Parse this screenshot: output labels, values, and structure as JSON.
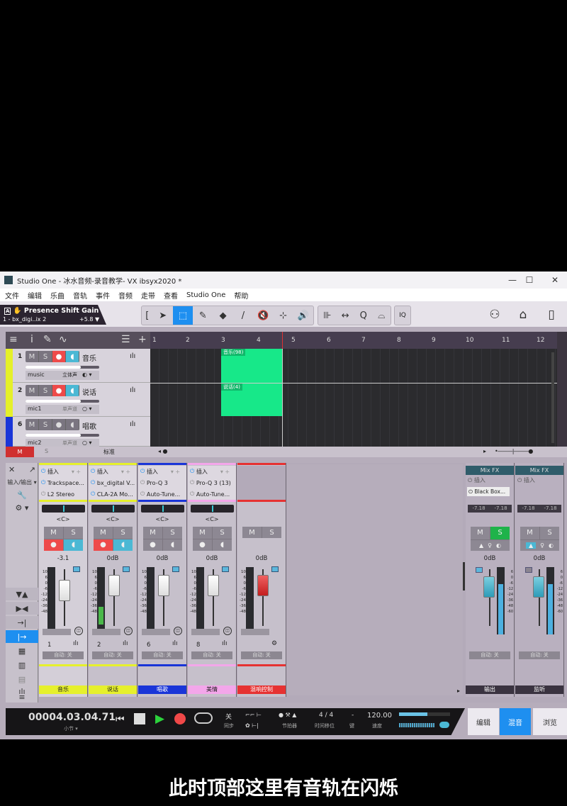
{
  "window": {
    "title": "Studio One - 冰水音频-录音教学- VX  ibsyx2020  *",
    "controls": {
      "minimize": "—",
      "maximize": "☐",
      "close": "✕"
    }
  },
  "menu": [
    "文件",
    "编辑",
    "乐曲",
    "音轨",
    "事件",
    "音频",
    "走带",
    "查看",
    "Studio One",
    "帮助"
  ],
  "info_box": {
    "title": "Presence Shift Gain",
    "device": "1 - bx_digi..ix 2",
    "value": "+5.8 ▼",
    "icons": [
      "A",
      "✋"
    ]
  },
  "toolbar": {
    "tools": [
      {
        "name": "bracket",
        "glyph": "["
      },
      {
        "name": "arrow-tool",
        "glyph": "➤"
      },
      {
        "name": "range-tool",
        "glyph": "⬚",
        "active": true
      },
      {
        "name": "split-tool",
        "glyph": "✎"
      },
      {
        "name": "eraser-tool",
        "glyph": "◆"
      },
      {
        "name": "paint-tool",
        "glyph": "/"
      },
      {
        "name": "mute-tool",
        "glyph": "🔇"
      },
      {
        "name": "bend-tool",
        "glyph": "⊹"
      },
      {
        "name": "listen-tool",
        "glyph": "🔊"
      }
    ],
    "group2": [
      {
        "name": "snap",
        "glyph": "⊪"
      },
      {
        "name": "stretch",
        "glyph": "↔"
      },
      {
        "name": "quantize",
        "glyph": "Q"
      },
      {
        "name": "autoscroll",
        "glyph": "⌓"
      }
    ],
    "iq": "IQ",
    "right_icons": [
      "user-icon",
      "home-icon",
      "layout-icon"
    ]
  },
  "arrange": {
    "header_icons": [
      "≡",
      "i",
      "✎",
      "∿",
      "☰",
      "+"
    ],
    "tracks": [
      {
        "num": "1",
        "name": "音乐",
        "input": "music",
        "mode": "立体声",
        "color": "#e5f02a",
        "volume": 0.75,
        "armed": true
      },
      {
        "num": "2",
        "name": "说话",
        "input": "mic1",
        "mode": "单声道",
        "color": "#e5f02a",
        "volume": 0.75,
        "armed": true
      },
      {
        "num": "6",
        "name": "唱歌",
        "input": "mic2",
        "mode": "单声道",
        "color": "#1a35d8",
        "volume": 0.75,
        "armed": false
      }
    ],
    "buttons": {
      "m": "M",
      "s": "S"
    },
    "ruler": [
      "1",
      "2",
      "3",
      "4",
      "5",
      "6",
      "7",
      "8",
      "9",
      "10",
      "11",
      "12"
    ],
    "clips": [
      {
        "label": "音乐(98)",
        "track": 0
      },
      {
        "label": "说话(4)",
        "track": 1
      }
    ],
    "bottom": {
      "m": "M",
      "s": "S",
      "view": "标准"
    }
  },
  "mixer": {
    "left_icons": [
      "✕",
      "↗",
      "输入/输出 ▾",
      "🔧",
      "⚙ ▾"
    ],
    "side_buttons": [
      "▼▲",
      "▶◀",
      "→|",
      "|→",
      "▦",
      "▥",
      "▤",
      "ılı",
      "≡"
    ],
    "channels": [
      {
        "num": "1",
        "name": "音乐",
        "color": "#e6f02c",
        "insert_label": "插入",
        "inserts": [
          "Trackspace...",
          "L2 Stereo"
        ],
        "pan": "<C>",
        "db": "-3.1",
        "auto": "自动: 关",
        "armed": true
      },
      {
        "num": "2",
        "name": "说话",
        "color": "#e6f02c",
        "insert_label": "插入",
        "inserts": [
          "bx_digital V...",
          "CLA-2A Mo..."
        ],
        "pan": "<C>",
        "db": "0dB",
        "auto": "自动: 关",
        "armed": true
      },
      {
        "num": "6",
        "name": "唱歌",
        "color": "#1a35d8",
        "insert_label": "插入",
        "inserts": [
          "Pro-Q 3",
          "Auto-Tune..."
        ],
        "pan": "<C>",
        "db": "0dB",
        "auto": "自动: 关",
        "armed": false
      },
      {
        "num": "8",
        "name": "美情",
        "color": "#f3a6ea",
        "insert_label": "插入",
        "inserts": [
          "Pro-Q 3 (13)",
          "Auto-Tune..."
        ],
        "pan": "<C>",
        "db": "0dB",
        "auto": "自动: 关",
        "armed": false
      },
      {
        "num": "",
        "name": "混响控制",
        "color": "#e63232",
        "insert_label": "",
        "inserts": [],
        "pan": "",
        "db": "0dB",
        "auto": "自动: 关",
        "armed": false
      }
    ],
    "buses": [
      {
        "name": "输出",
        "mixfx": "Mix FX",
        "insert_label": "插入",
        "inserts": [
          "Black Box..."
        ],
        "peak_l": "-7.18",
        "peak_r": "-7.18",
        "db": "0dB",
        "auto": "自动: 关",
        "solo": true
      },
      {
        "name": "监听",
        "mixfx": "Mix FX",
        "insert_label": "插入",
        "inserts": [],
        "peak_l": "-7.18",
        "peak_r": "-7.18",
        "db": "0dB",
        "auto": "自动: 关",
        "solo": false
      }
    ],
    "scale": [
      "10",
      "6",
      "0",
      "-6",
      "-12",
      "-24",
      "-36",
      "-48"
    ]
  },
  "transport": {
    "time": "00004.03.04.71",
    "time_unit": "小节 ▾",
    "sync_top": "关",
    "sync_label": "同步",
    "metronome_label": "节拍器",
    "signature": "4 / 4",
    "signature_label": "时间移位",
    "key": "-",
    "key_label": "键",
    "tempo": "120.00",
    "tempo_label": "速度",
    "modes": [
      "编辑",
      "混音",
      "浏览"
    ],
    "active_mode": "混音"
  },
  "subtitle": "此时顶部这里有音轨在闪烁"
}
